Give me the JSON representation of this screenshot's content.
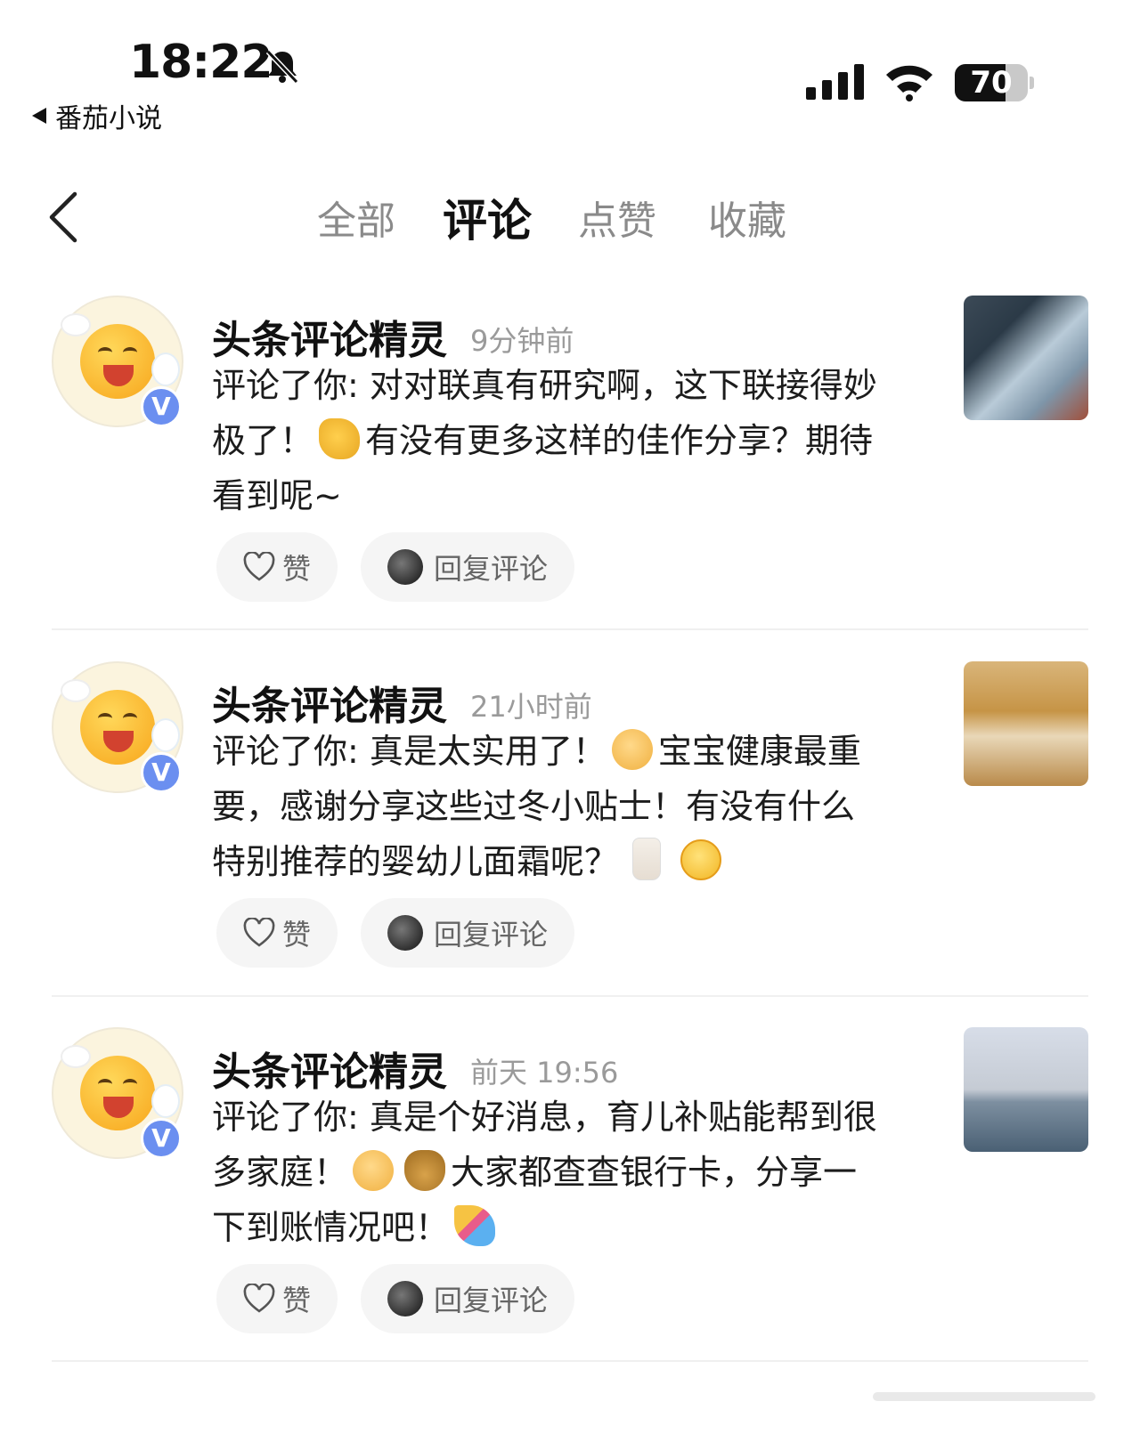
{
  "status_bar": {
    "time": "18:22",
    "back_app": "番茄小说",
    "battery": "70",
    "battery_level": 0.7
  },
  "tabs": [
    {
      "label": "全部",
      "active": false
    },
    {
      "label": "评论",
      "active": true
    },
    {
      "label": "点赞",
      "active": false
    },
    {
      "label": "收藏",
      "active": false
    }
  ],
  "comments": [
    {
      "name": "头条评论精灵",
      "time": "9分钟前",
      "lines": [
        "评论了你: 对对联真有研究啊，这下联接得妙",
        "极了！",
        "有没有更多这样的佳作分享？期待",
        "看到呢~"
      ],
      "like_label": "赞",
      "reply_label": "回复评论"
    },
    {
      "name": "头条评论精灵",
      "time": "21小时前",
      "lines": [
        "评论了你: 真是太实用了！",
        "宝宝健康最重",
        "要，感谢分享这些过冬小贴士！有没有什么",
        "特别推荐的婴幼儿面霜呢？"
      ],
      "like_label": "赞",
      "reply_label": "回复评论"
    },
    {
      "name": "头条评论精灵",
      "time": "前天 19:56",
      "lines": [
        "评论了你: 真是个好消息，育儿补贴能帮到很",
        "多家庭！",
        "大家都查查银行卡，分享一",
        "下到账情况吧！"
      ],
      "like_label": "赞",
      "reply_label": "回复评论"
    }
  ],
  "icons": {
    "bell": "bell-slash-icon",
    "back": "chevron-left-icon",
    "like": "heart-icon",
    "verified": "V"
  }
}
